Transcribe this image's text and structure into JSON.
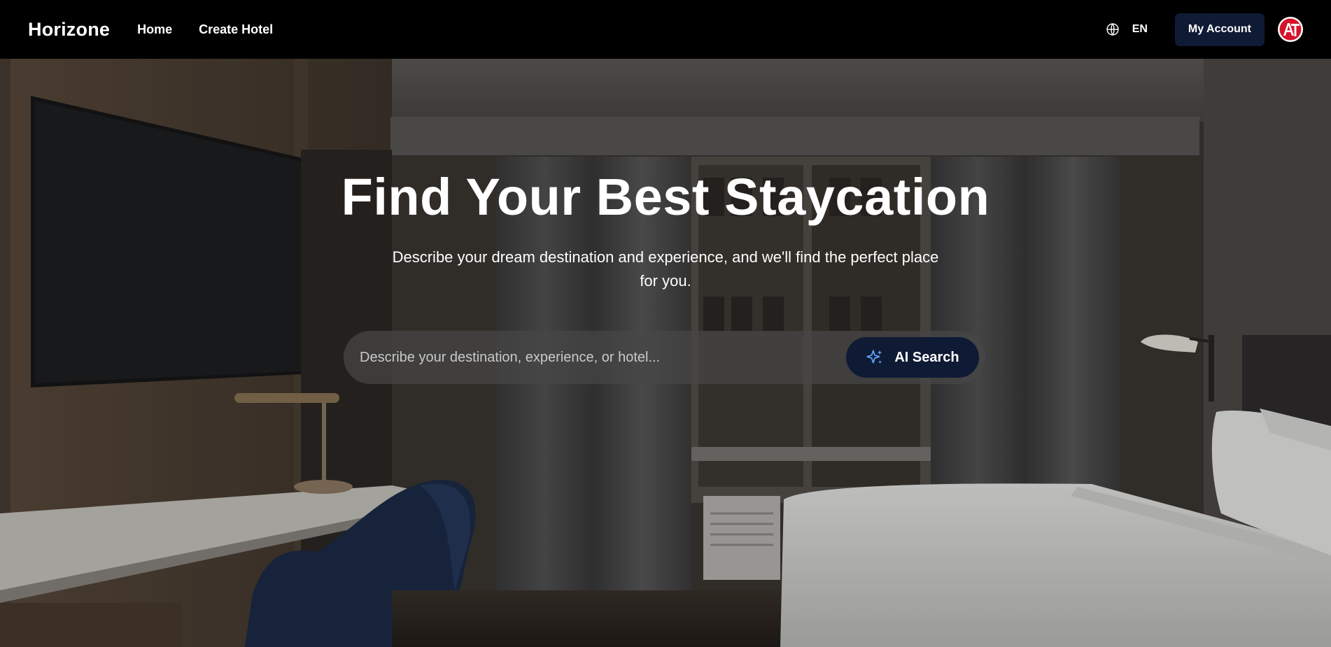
{
  "nav": {
    "brand": "Horizone",
    "links": [
      "Home",
      "Create Hotel"
    ],
    "language": "EN",
    "account_label": "My Account",
    "avatar_initials": "AT"
  },
  "hero": {
    "title": "Find Your Best Staycation",
    "subtitle": "Describe your dream destination and experience, and we'll find the perfect place for you.",
    "search_placeholder": "Describe your destination, experience, or hotel...",
    "search_button": "AI Search"
  },
  "icons": {
    "language": "globe-icon",
    "search_button": "sparkle-icon"
  },
  "colors": {
    "navbar": "#000000",
    "button_bg": "#0f1a34",
    "sparkle": "#5fa8ff",
    "avatar_red": "#d6122a"
  }
}
